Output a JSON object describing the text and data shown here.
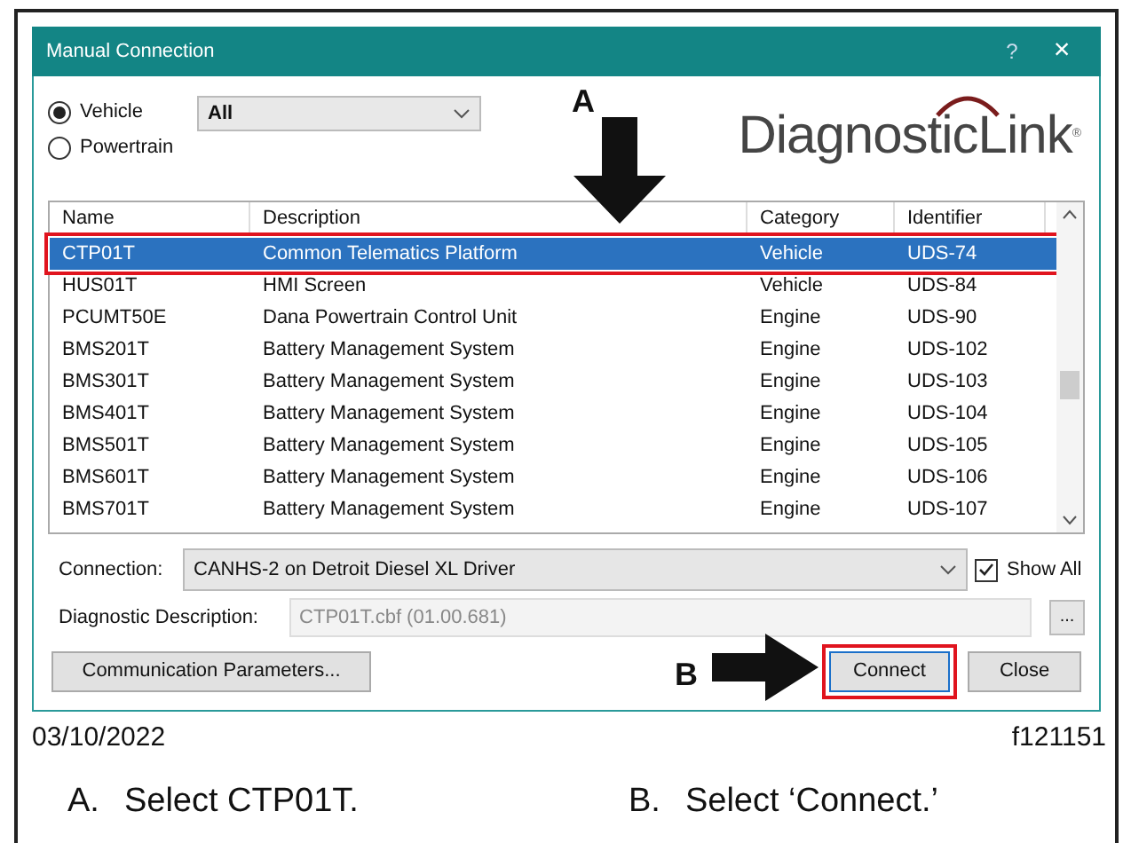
{
  "window": {
    "title": "Manual Connection",
    "buttons": [
      "?",
      "×"
    ]
  },
  "filter": {
    "options": [
      {
        "label": "Vehicle",
        "selected": true
      },
      {
        "label": "Powertrain",
        "selected": false
      }
    ],
    "dropdown": "All"
  },
  "logo": {
    "text": "DiagnosticLink",
    "mark": "®"
  },
  "table": {
    "columns": [
      "Name",
      "Description",
      "Category",
      "Identifier"
    ],
    "rows": [
      {
        "cells": [
          "CTP01T",
          "Common Telematics Platform",
          "Vehicle",
          "UDS-74"
        ],
        "selected": true,
        "highlighted": true
      },
      {
        "cells": [
          "HUS01T",
          "HMI Screen",
          "Vehicle",
          "UDS-84"
        ],
        "selected": false,
        "highlighted": false
      },
      {
        "cells": [
          "PCUMT50E",
          "Dana Powertrain Control Unit",
          "Engine",
          "UDS-90"
        ],
        "selected": false,
        "highlighted": false
      },
      {
        "cells": [
          "BMS201T",
          "Battery Management System",
          "Engine",
          "UDS-102"
        ],
        "selected": false,
        "highlighted": false
      },
      {
        "cells": [
          "BMS301T",
          "Battery Management System",
          "Engine",
          "UDS-103"
        ],
        "selected": false,
        "highlighted": false
      },
      {
        "cells": [
          "BMS401T",
          "Battery Management System",
          "Engine",
          "UDS-104"
        ],
        "selected": false,
        "highlighted": false
      },
      {
        "cells": [
          "BMS501T",
          "Battery Management System",
          "Engine",
          "UDS-105"
        ],
        "selected": false,
        "highlighted": false
      },
      {
        "cells": [
          "BMS601T",
          "Battery Management System",
          "Engine",
          "UDS-106"
        ],
        "selected": false,
        "highlighted": false
      },
      {
        "cells": [
          "BMS701T",
          "Battery Management System",
          "Engine",
          "UDS-107"
        ],
        "selected": false,
        "highlighted": false
      }
    ]
  },
  "connection": {
    "label": "Connection:",
    "value": "CANHS-2 on Detroit Diesel XL Driver",
    "show_all": {
      "label": "Show All",
      "checked": true
    }
  },
  "diagnostic_description": {
    "label": "Diagnostic Description:",
    "value": "CTP01T.cbf (01.00.681)",
    "browse": "..."
  },
  "buttons": [
    {
      "label": "Communication Parameters...",
      "highlighted": false
    },
    {
      "label": "Connect",
      "highlighted": true
    },
    {
      "label": "Close",
      "highlighted": false
    }
  ],
  "callouts": [
    "A",
    "B"
  ],
  "footer": {
    "date": "03/10/2022",
    "figure_id": "f121151"
  },
  "captions": [
    {
      "letter": "A.",
      "text": "Select CTP01T."
    },
    {
      "letter": "B.",
      "text": "Select ‘Connect.’"
    }
  ]
}
